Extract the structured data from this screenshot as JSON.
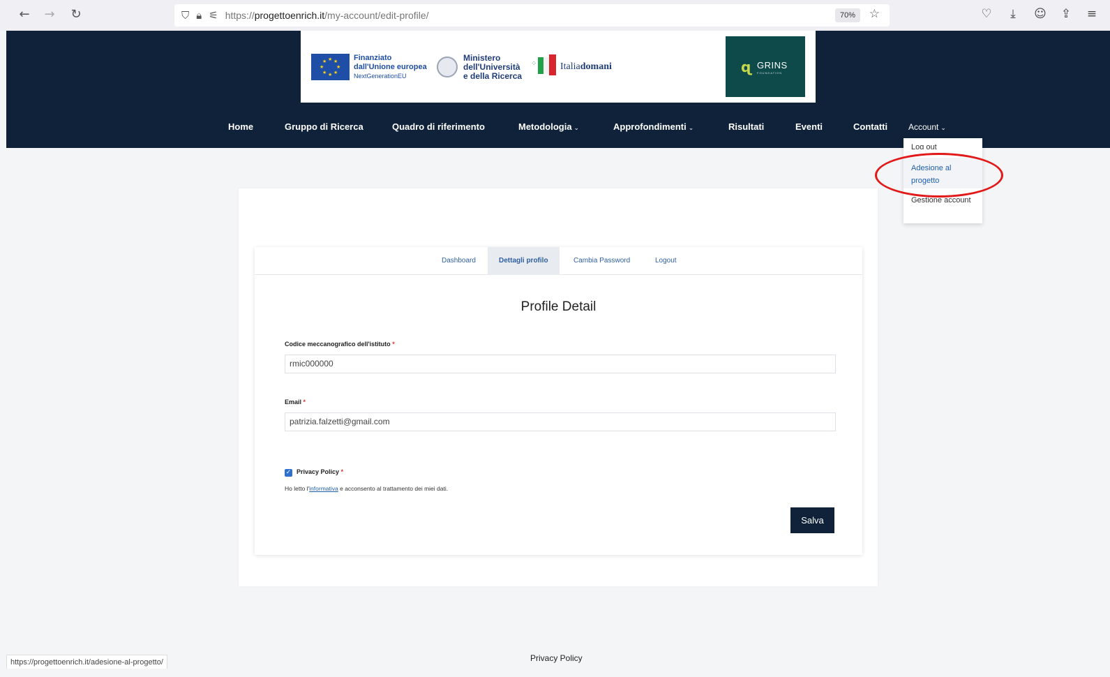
{
  "browser": {
    "back_icon": "←",
    "forward_icon": "→",
    "reload_icon": "↻",
    "url_host": "progettoenrich.it",
    "url_prefix": "https://",
    "url_path": "/my-account/edit-profile/",
    "zoom": "70%",
    "status_url": "https://progettoenrich.it/adesione-al-progetto/"
  },
  "logos": {
    "eu_line1": "Finanziato",
    "eu_line2": "dall'Unione europea",
    "eu_line3": "NextGenerationEU",
    "mur_line1": "Ministero",
    "mur_line2": "dell'Università",
    "mur_line3": "e della Ricerca",
    "italia_a": "Italia",
    "italia_b": "domani",
    "grins": "GRINS",
    "grins_sub": "FOUNDATION"
  },
  "nav": {
    "home": "Home",
    "gruppo": "Gruppo di Ricerca",
    "quadro": "Quadro di riferimento",
    "metodologia": "Metodologia",
    "approfondimenti": "Approfondimenti",
    "risultati": "Risultati",
    "eventi": "Eventi",
    "contatti": "Contatti",
    "account": "Account"
  },
  "dropdown": {
    "item1": "Log out",
    "item2": "Adesione al progetto",
    "item3": "Gestione account"
  },
  "tabs": {
    "dashboard": "Dashboard",
    "dettagli": "Dettagli profilo",
    "cambia": "Cambia Password",
    "logout": "Logout"
  },
  "form": {
    "title": "Profile Detail",
    "codice_label": "Codice meccanografico dell'istituto",
    "codice_value": "rmic000000",
    "email_label": "Email",
    "email_value": "patrizia.falzetti@gmail.com",
    "required_mark": "*",
    "privacy_label": "Privacy Policy",
    "consent_pre": "Ho letto l'",
    "consent_link": "informativa",
    "consent_post": " e acconsento al trattamento dei miei dati.",
    "save": "Salva"
  },
  "footer": {
    "privacy": "Privacy Policy"
  },
  "colors": {
    "header_bg": "#0f2239",
    "accent": "#2f6fd0",
    "highlight_ring": "#e21919"
  }
}
